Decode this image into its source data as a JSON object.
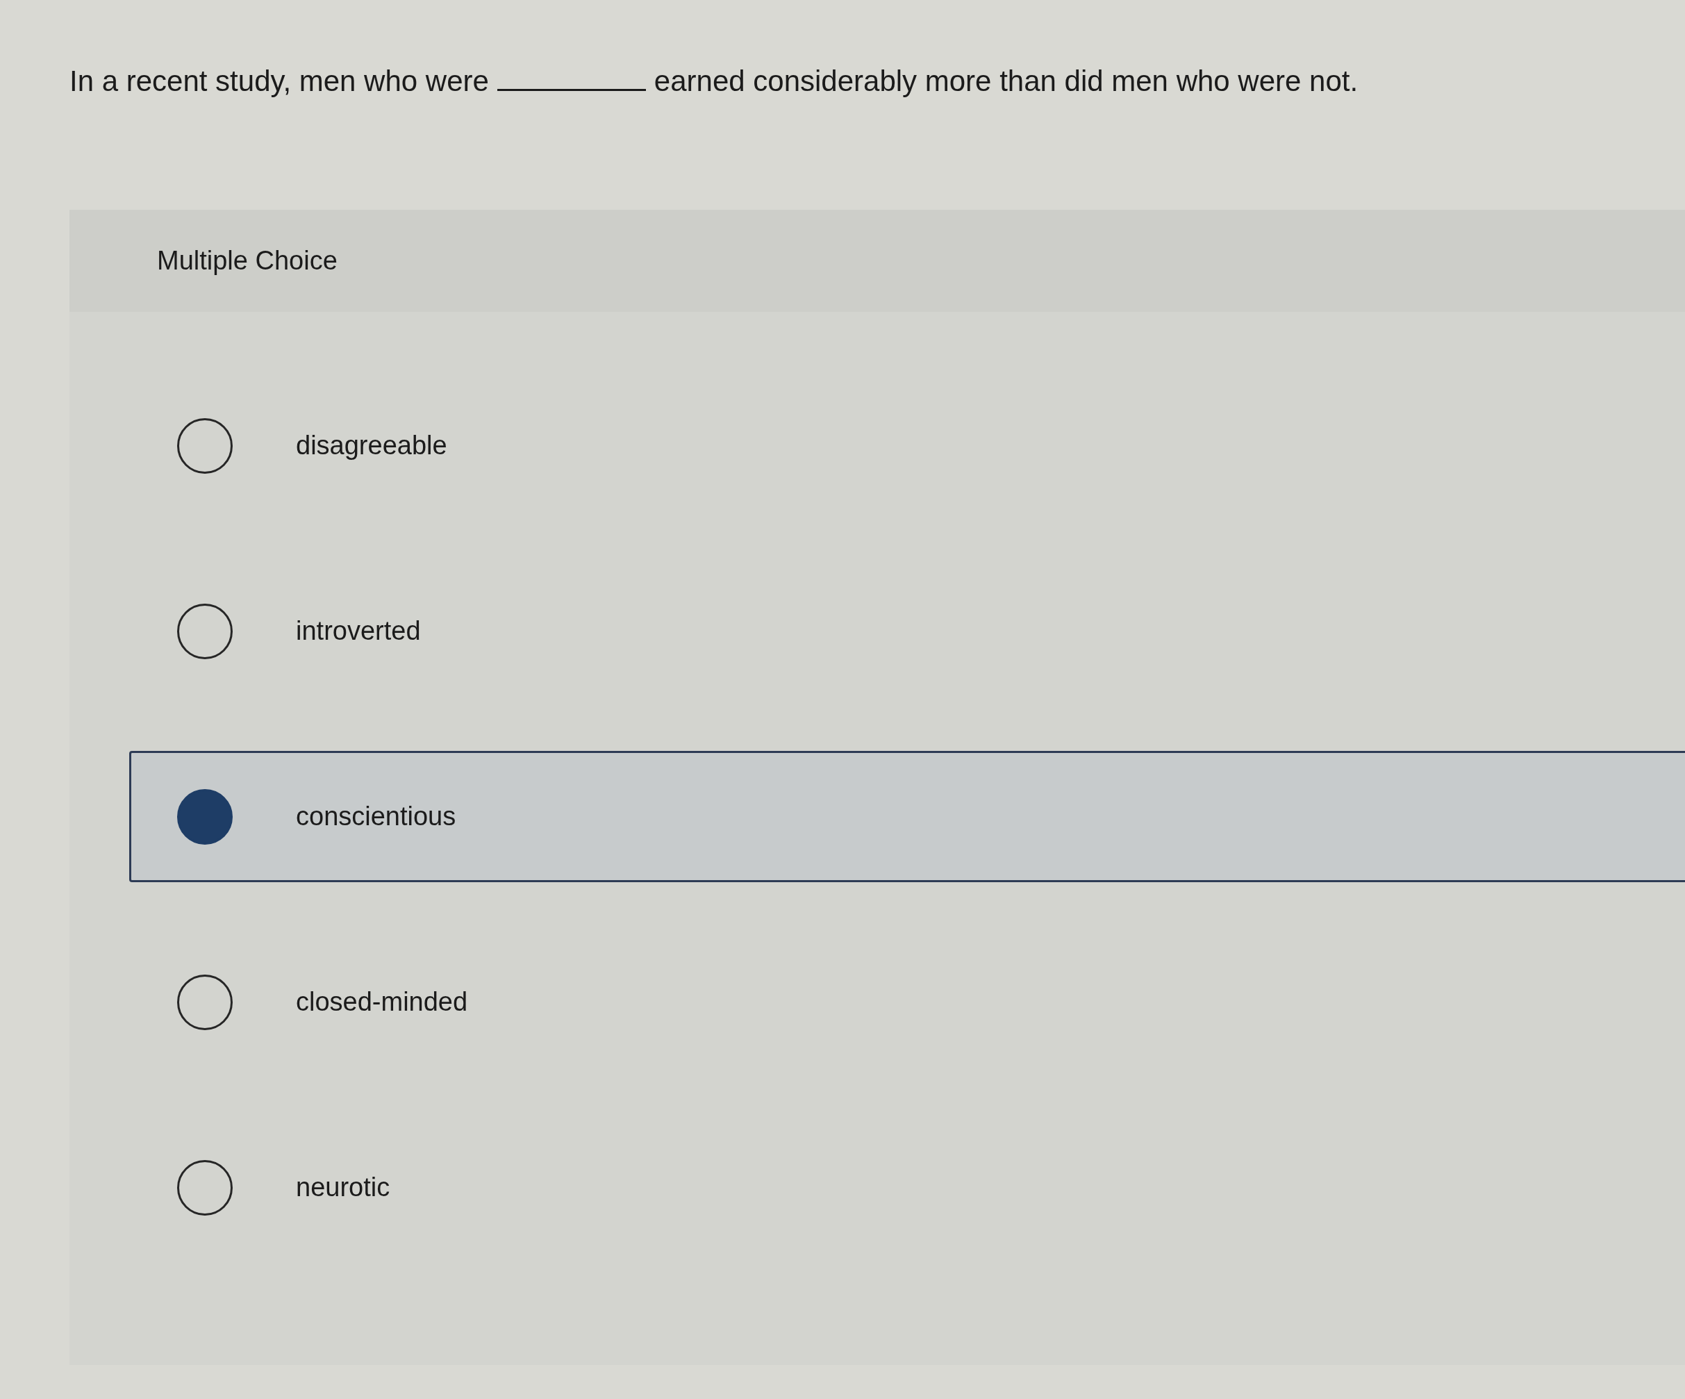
{
  "question": {
    "before": "In a recent study, men who were",
    "after": "earned considerably more than did men who were not."
  },
  "panel": {
    "header": "Multiple Choice"
  },
  "options": [
    {
      "label": "disagreeable",
      "selected": false
    },
    {
      "label": "introverted",
      "selected": false
    },
    {
      "label": "conscientious",
      "selected": true
    },
    {
      "label": "closed-minded",
      "selected": false
    },
    {
      "label": "neurotic",
      "selected": false
    }
  ]
}
